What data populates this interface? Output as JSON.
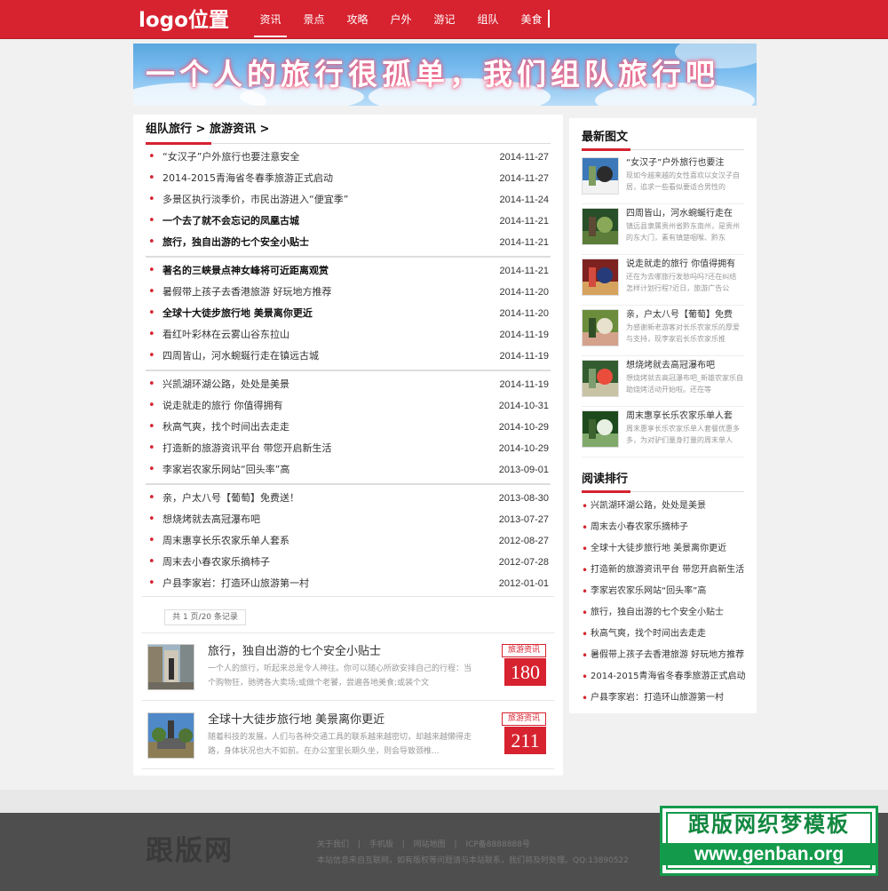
{
  "header": {
    "logo": "logo位置",
    "nav": [
      "资讯",
      "景点",
      "攻略",
      "户外",
      "游记",
      "组队",
      "美食"
    ],
    "active_index": 0
  },
  "banner": {
    "text": "一个人的旅行很孤单，我们组队旅行吧"
  },
  "breadcrumb": "组队旅行 > 旅游资讯 >",
  "news": [
    {
      "title": "“女汉子”户外旅行也要注意安全",
      "date": "2014-11-27",
      "bold": false
    },
    {
      "title": "2014-2015青海省冬春季旅游正式启动",
      "date": "2014-11-27",
      "bold": false
    },
    {
      "title": "多景区执行淡季价，市民出游进入“便宜季”",
      "date": "2014-11-24",
      "bold": false
    },
    {
      "title": "一个去了就不会忘记的凤凰古城",
      "date": "2014-11-21",
      "bold": true
    },
    {
      "title": "旅行，独自出游的七个安全小贴士",
      "date": "2014-11-21",
      "bold": true
    },
    {
      "title": "著名的三峡景点神女峰将可近距离观赏",
      "date": "2014-11-21",
      "bold": true
    },
    {
      "title": "暑假带上孩子去香港旅游 好玩地方推荐",
      "date": "2014-11-20",
      "bold": false
    },
    {
      "title": "全球十大徒步旅行地 美景离你更近",
      "date": "2014-11-20",
      "bold": true
    },
    {
      "title": "看红叶彩林在云雾山谷东拉山",
      "date": "2014-11-19",
      "bold": false
    },
    {
      "title": "四周皆山，河水蜿蜒行走在镇远古城",
      "date": "2014-11-19",
      "bold": false
    },
    {
      "title": "兴凯湖环湖公路，处处是美景",
      "date": "2014-11-19",
      "bold": false
    },
    {
      "title": "说走就走的旅行 你值得拥有",
      "date": "2014-10-31",
      "bold": false
    },
    {
      "title": "秋高气爽，找个时间出去走走",
      "date": "2014-10-29",
      "bold": false
    },
    {
      "title": "打造新的旅游资讯平台 带您开启新生活",
      "date": "2014-10-29",
      "bold": false
    },
    {
      "title": "李家岩农家乐网站“回头率”高",
      "date": "2013-09-01",
      "bold": false
    },
    {
      "title": "亲，户太八号【葡萄】免费送！",
      "date": "2013-08-30",
      "bold": false
    },
    {
      "title": "想烧烤就去高冠瀑布吧",
      "date": "2013-07-27",
      "bold": false
    },
    {
      "title": "周末惠享长乐农家乐单人套系",
      "date": "2012-08-27",
      "bold": false
    },
    {
      "title": "周末去小春农家乐摘柿子",
      "date": "2012-07-28",
      "bold": false
    },
    {
      "title": "户县李家岩：打造环山旅游第一村",
      "date": "2012-01-01",
      "bold": false
    }
  ],
  "pager": "共 1 页/20 条记录",
  "articles": [
    {
      "title": "旅行，独自出游的七个安全小贴士",
      "desc": "一个人的旅行，听起来总是令人神往。你可以随心所欲安排自己的行程：当个购物狂，驰骋各大卖场;或做个老饕，尝遍各地美食;或装个文",
      "tag": "旅游资讯",
      "count": "180"
    },
    {
      "title": "全球十大徒步旅行地 美景离你更近",
      "desc": "随着科技的发展，人们与各种交通工具的联系越来越密切，却越来越懒得走路，身体状况也大不如前。在办公室里长期久坐，则会导致颈椎...",
      "tag": "旅游资讯",
      "count": "211"
    }
  ],
  "sidebar": {
    "latest_title": "最新图文",
    "latest": [
      {
        "title": "“女汉子”户外旅行也要注",
        "desc": "现如今越来越的女性喜欢以女汉子自居，追求一些看似要适合男性的"
      },
      {
        "title": "四周皆山，河水蜿蜒行走在",
        "desc": "镇远县隶属贵州省黔东南州，是贵州的东大门，素有镇楚咽喉、黔东"
      },
      {
        "title": "说走就走的旅行 你值得拥有",
        "desc": "还在为去哪旅行发愁吗吗?还在纠结怎样计划行程?近日，旅游广告公"
      },
      {
        "title": "亲，户太八号【葡萄】免费",
        "desc": "为感谢新老游客对长乐农家乐的厚爱与支持，现李家岩长乐农家乐推"
      },
      {
        "title": "想烧烤就去高冠瀑布吧",
        "desc": "想烧烤就去高冠瀑布吧_新雄农家乐自助烧烤活动开始啦。还在等"
      },
      {
        "title": "周末惠享长乐农家乐单人套",
        "desc": "周末惠享长乐农家乐单人套餐优惠多多，为对驴们量身打量的周末单人"
      }
    ],
    "rank_title": "阅读排行",
    "rank": [
      "兴凯湖环湖公路，处处是美景",
      "周末去小春农家乐摘柿子",
      "全球十大徒步旅行地 美景离你更近",
      "打造新的旅游资讯平台 带您开启新生活",
      "李家岩农家乐网站“回头率”高",
      "旅行，独自出游的七个安全小贴士",
      "秋高气爽，找个时间出去走走",
      "暑假带上孩子去香港旅游 好玩地方推荐",
      "2014-2015青海省冬春季旅游正式启动",
      "户县李家岩：打造环山旅游第一村"
    ]
  },
  "footer": {
    "name": "跟版网",
    "links": [
      "关于我们",
      "|",
      "手机版",
      "|",
      "网站地图",
      "|",
      "ICP备8888888号"
    ],
    "info": "本站信息来自互联网，如有版权等问题请与本站联系，我们将及时处理。QQ:13890522"
  },
  "stamp": {
    "title": "跟版网织梦模板",
    "url": "www.genban.org"
  },
  "colors": {
    "brand": "#d7222f",
    "footer": "#4e4e4e",
    "stamp": "#139b4b"
  }
}
